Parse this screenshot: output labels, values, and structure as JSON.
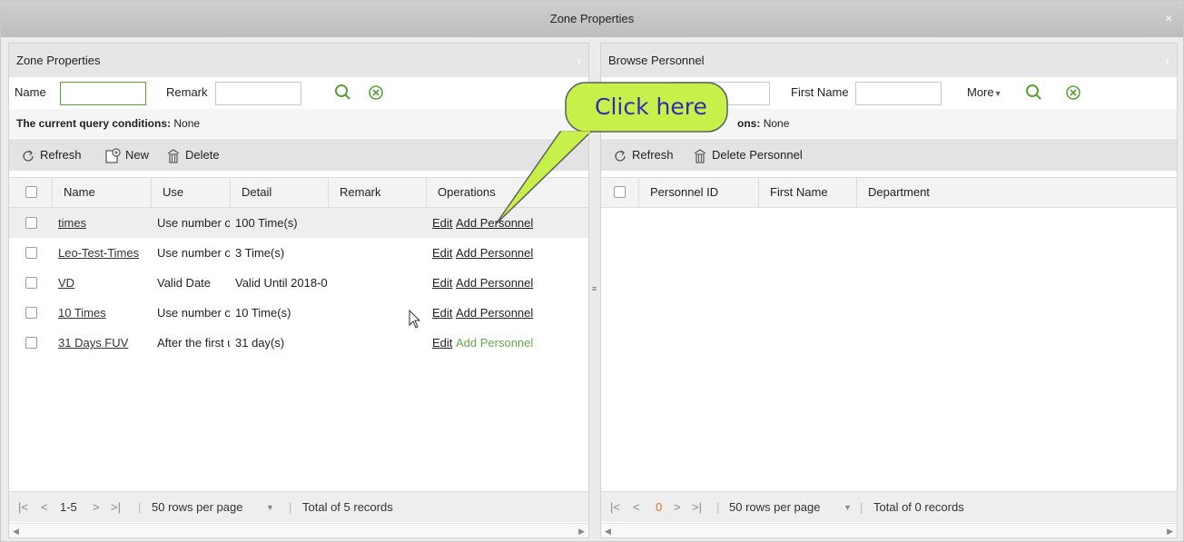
{
  "window": {
    "title": "Zone Properties",
    "close_glyph": "×"
  },
  "left": {
    "title": "Zone Properties",
    "search": {
      "name_label": "Name",
      "name_value": "",
      "remark_label": "Remark",
      "remark_value": ""
    },
    "query": {
      "label": "The current query conditions:",
      "value": "None"
    },
    "toolbar": {
      "refresh": "Refresh",
      "new": "New",
      "delete": "Delete"
    },
    "columns": [
      "Name",
      "Use",
      "Detail",
      "Remark",
      "Operations"
    ],
    "rows": [
      {
        "name": "times",
        "use": "Use number o",
        "detail": "100 Time(s)",
        "remark": "",
        "edit": "Edit",
        "add": "Add Personnel"
      },
      {
        "name": "Leo-Test-Times",
        "use": "Use number o",
        "detail": "3 Time(s)",
        "remark": "",
        "edit": "Edit",
        "add": "Add Personnel"
      },
      {
        "name": "VD",
        "use": "Valid Date",
        "detail": "Valid Until 2018-0",
        "remark": "",
        "edit": "Edit",
        "add": "Add Personnel"
      },
      {
        "name": "10 Times",
        "use": "Use number o",
        "detail": "10 Time(s)",
        "remark": "",
        "edit": "Edit",
        "add": "Add Personnel"
      },
      {
        "name": "31 Days FUV",
        "use": "After the first u",
        "detail": "31 day(s)",
        "remark": "",
        "edit": "Edit",
        "add": "Add Personnel"
      }
    ],
    "footer": {
      "first": "|<",
      "prev": "<",
      "range": "1-5",
      "next": ">",
      "last": ">|",
      "per_page": "50 rows per page",
      "total": "Total of 5 records"
    }
  },
  "right": {
    "title": "Browse Personnel",
    "search": {
      "first_name_label": "First Name",
      "first_name_value": "",
      "more": "More"
    },
    "query": {
      "label": "ons:",
      "value": "None"
    },
    "toolbar": {
      "refresh": "Refresh",
      "delete_personnel": "Delete Personnel"
    },
    "columns": [
      "Personnel ID",
      "First Name",
      "Department"
    ],
    "footer": {
      "first": "|<",
      "prev": "<",
      "page": "0",
      "next": ">",
      "last": ">|",
      "per_page": "50 rows per page",
      "total": "Total of 0 records"
    }
  },
  "callout": {
    "text": "Click here"
  },
  "colors": {
    "accent_green": "#6aa84f",
    "callout_fill": "#c8f04a",
    "page_current": "#d97a2a"
  },
  "icons": [
    "close-icon",
    "collapse-left-icon",
    "expand-right-icon",
    "search-icon",
    "clear-icon",
    "refresh-icon",
    "new-icon",
    "delete-icon",
    "dropdown-arrow-icon",
    "mouse-cursor-icon"
  ]
}
